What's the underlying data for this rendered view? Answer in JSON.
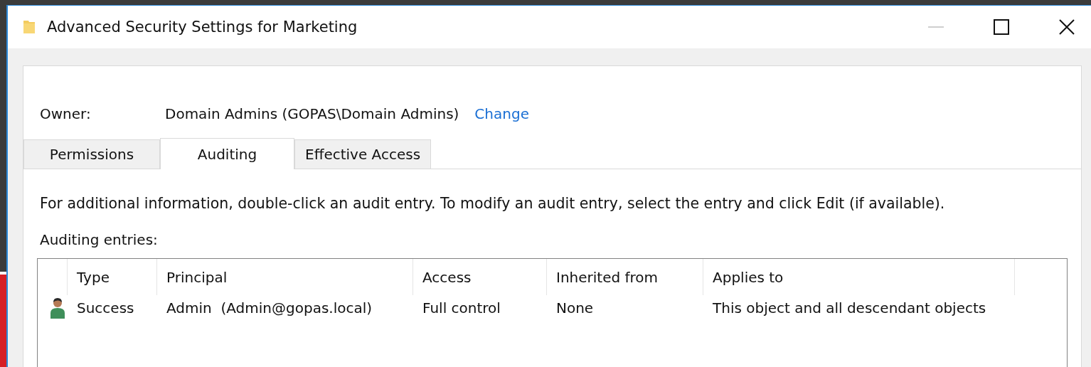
{
  "window": {
    "title": "Advanced Security Settings for Marketing"
  },
  "owner": {
    "label": "Owner:",
    "value": "Domain Admins (GOPAS\\Domain Admins)",
    "link": "Change"
  },
  "tabs": [
    {
      "label": "Permissions",
      "selected": false
    },
    {
      "label": "Auditing",
      "selected": true
    },
    {
      "label": "Effective Access",
      "selected": false
    }
  ],
  "description": "For additional information, double-click an audit entry. To modify an audit entry, select the entry and click Edit (if available).",
  "entries_label": "Auditing entries:",
  "table": {
    "columns": [
      "Type",
      "Principal",
      "Access",
      "Inherited from",
      "Applies to"
    ],
    "rows": [
      {
        "cells": [
          "Success",
          "Admin  (Admin@gopas.local)",
          "Full control",
          "None",
          "This object and all descendant objects"
        ]
      }
    ]
  }
}
